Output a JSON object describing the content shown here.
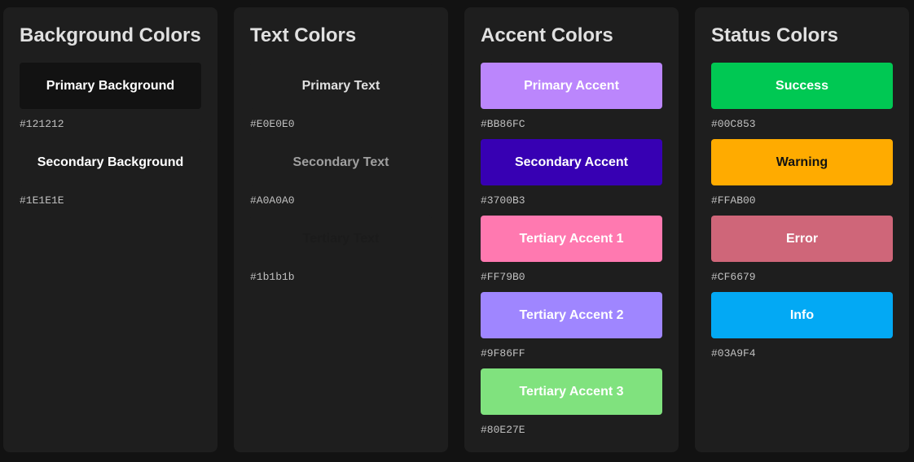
{
  "palettes": [
    {
      "title": "Background Colors",
      "swatches": [
        {
          "label": "Primary Background",
          "hex": "#121212",
          "bg": "#121212",
          "fg": "#FFFFFF"
        },
        {
          "label": "Secondary Background",
          "hex": "#1E1E1E",
          "bg": "#1E1E1E",
          "fg": "#FFFFFF"
        }
      ]
    },
    {
      "title": "Text Colors",
      "swatches": [
        {
          "label": "Primary Text",
          "hex": "#E0E0E0",
          "bg": "#1E1E1E",
          "fg": "#E0E0E0"
        },
        {
          "label": "Secondary Text",
          "hex": "#A0A0A0",
          "bg": "#1E1E1E",
          "fg": "#A0A0A0"
        },
        {
          "label": "Tertiary Text",
          "hex": "#1b1b1b",
          "bg": "#1E1E1E",
          "fg": "#1b1b1b"
        }
      ]
    },
    {
      "title": "Accent Colors",
      "swatches": [
        {
          "label": "Primary Accent",
          "hex": "#BB86FC",
          "bg": "#BB86FC",
          "fg": "#FFFFFF"
        },
        {
          "label": "Secondary Accent",
          "hex": "#3700B3",
          "bg": "#3700B3",
          "fg": "#FFFFFF"
        },
        {
          "label": "Tertiary Accent 1",
          "hex": "#FF79B0",
          "bg": "#FF79B0",
          "fg": "#FFFFFF"
        },
        {
          "label": "Tertiary Accent 2",
          "hex": "#9F86FF",
          "bg": "#9F86FF",
          "fg": "#FFFFFF"
        },
        {
          "label": "Tertiary Accent 3",
          "hex": "#80E27E",
          "bg": "#80E27E",
          "fg": "#FFFFFF"
        }
      ]
    },
    {
      "title": "Status Colors",
      "swatches": [
        {
          "label": "Success",
          "hex": "#00C853",
          "bg": "#00C853",
          "fg": "#FFFFFF"
        },
        {
          "label": "Warning",
          "hex": "#FFAB00",
          "bg": "#FFAB00",
          "fg": "#121212"
        },
        {
          "label": "Error",
          "hex": "#CF6679",
          "bg": "#CF6679",
          "fg": "#FFFFFF"
        },
        {
          "label": "Info",
          "hex": "#03A9F4",
          "bg": "#03A9F4",
          "fg": "#FFFFFF"
        }
      ]
    }
  ]
}
